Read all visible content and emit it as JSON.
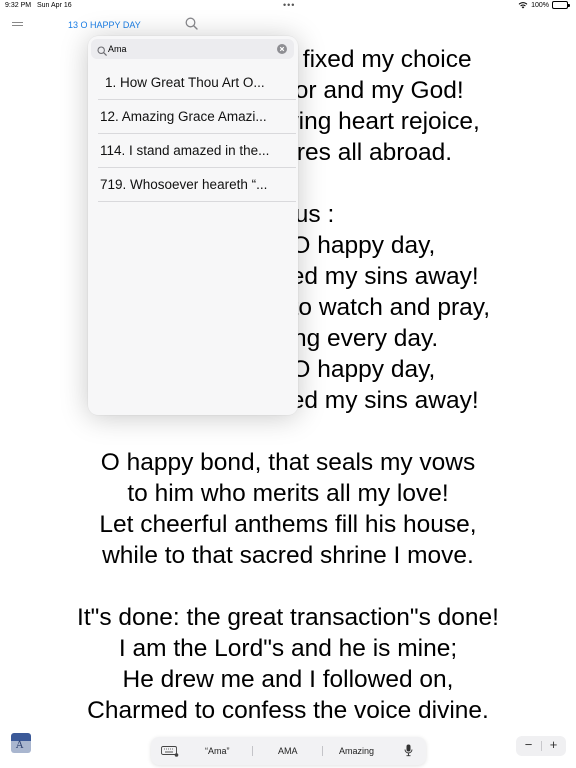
{
  "status_bar": {
    "time": "9:32 PM",
    "date": "Sun Apr 16",
    "dots": "•••",
    "battery": "100%"
  },
  "nav": {
    "title": "13 O HAPPY DAY"
  },
  "lyrics": {
    "lines": [
      "O happy day, that fixed my choice",
      "on thee, my Savior and my God!",
      "Well may this glowing heart rejoice,",
      "and tell its raptures all abroad.",
      "",
      "Chorus :",
      "O happy day, O happy day,",
      "when Jesus washed my sins away!",
      "He taught me how to watch and pray,",
      "and live rejoicing every day.",
      "O happy day, O happy day,",
      "when Jesus washed my sins away!",
      "",
      "O happy bond, that seals my vows",
      "to him who merits all my love!",
      "Let cheerful anthems fill his house,",
      "while to that sacred shrine I move.",
      "",
      "It\"s done: the great transaction\"s done!",
      "I am the Lord\"s and he is mine;",
      "He drew me and I followed on,",
      "Charmed to confess the voice divine."
    ]
  },
  "search": {
    "query": "Ama",
    "results": [
      "1. How Great Thou Art O...",
      "12. Amazing Grace Amazi...",
      "114. I stand amazed in the...",
      "719. Whosoever heareth “..."
    ]
  },
  "keyboard_bar": {
    "suggestions": [
      "“Ama”",
      "AMA",
      "Amazing"
    ]
  },
  "zoom": {
    "minus": "−",
    "plus": "+"
  },
  "app_icon_letter": "A",
  "colors": {
    "accent": "#1a7ee6"
  }
}
